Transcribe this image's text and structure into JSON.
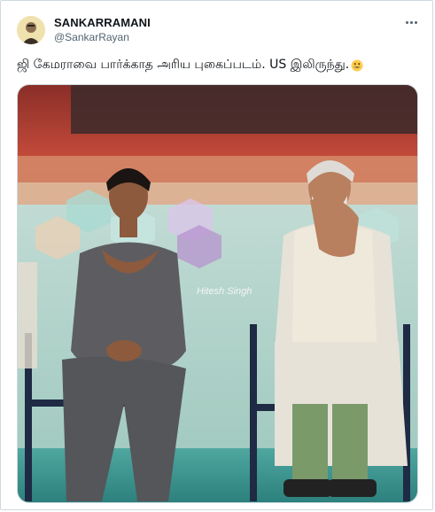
{
  "tweet": {
    "author_name": "SANKARRAMANI",
    "author_handle": "@SankarRayan",
    "text": "ஜி கேமராவை பார்க்காத அரிய புகைப்படம். US இலிருந்து.",
    "emoji": "grinning-face-emoji"
  },
  "media": {
    "watermark": "Hitesh Singh"
  },
  "icons": {
    "more": "more-horizontal-icon",
    "avatar": "user-avatar"
  },
  "colors": {
    "text_primary": "#0f1419",
    "text_secondary": "#536471",
    "border": "#cfd9de"
  }
}
